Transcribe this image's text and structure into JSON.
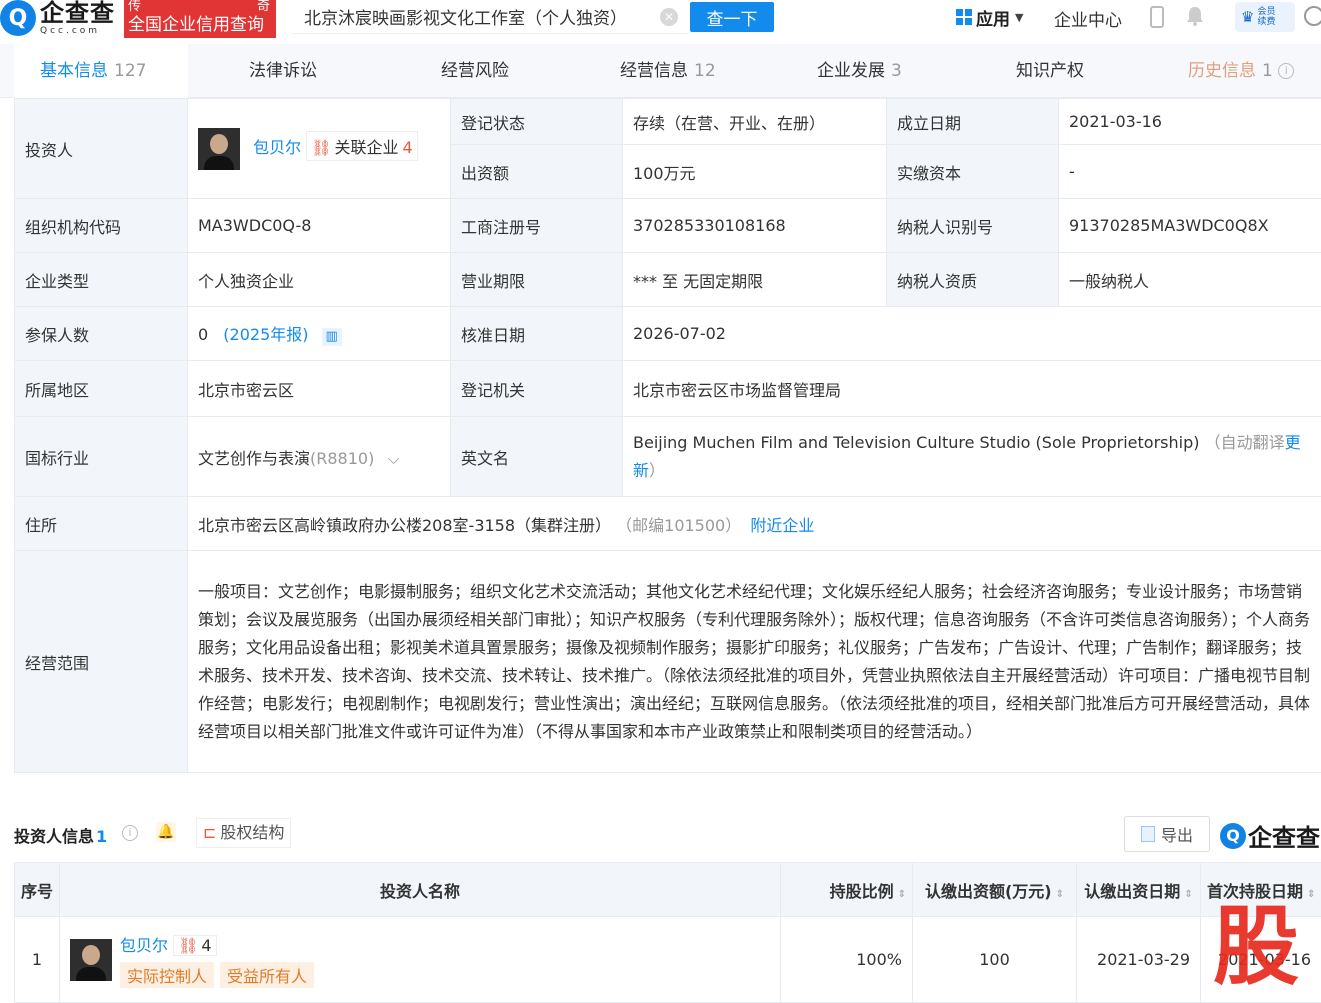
{
  "header": {
    "logo_name": "企查查",
    "logo_domain": "Qcc.com",
    "logo_red_top_left": "传",
    "logo_red_top_right": "奇",
    "logo_red_slogan": "全国企业信用查询",
    "search_value": "北京沐宸映画影视文化工作室（个人独资）",
    "search_button": "查一下",
    "app_menu": "应用",
    "enterprise_center": "企业中心",
    "vip_line1": "会员",
    "vip_line2": "续费"
  },
  "tabs": [
    {
      "label": "基本信息",
      "count": "127",
      "active": true
    },
    {
      "label": "法律诉讼",
      "count": ""
    },
    {
      "label": "经营风险",
      "count": ""
    },
    {
      "label": "经营信息",
      "count": "12"
    },
    {
      "label": "企业发展",
      "count": "3"
    },
    {
      "label": "知识产权",
      "count": ""
    },
    {
      "label": "历史信息",
      "count": "1"
    }
  ],
  "info": {
    "investor_label": "投资人",
    "investor_name": "包贝尔",
    "assoc_label": "关联企业",
    "assoc_count": "4",
    "reg_status_label": "登记状态",
    "reg_status": "存续（在营、开业、在册）",
    "est_date_label": "成立日期",
    "est_date": "2021-03-16",
    "capital_label": "出资额",
    "capital": "100万元",
    "paid_capital_label": "实缴资本",
    "paid_capital": "-",
    "org_code_label": "组织机构代码",
    "org_code": "MA3WDC0Q-8",
    "biz_reg_no_label": "工商注册号",
    "biz_reg_no": "370285330108168",
    "tax_id_label": "纳税人识别号",
    "tax_id": "91370285MA3WDC0Q8X",
    "ent_type_label": "企业类型",
    "ent_type": "个人独资企业",
    "biz_term_label": "营业期限",
    "biz_term": "*** 至 无固定期限",
    "tax_qual_label": "纳税人资质",
    "tax_qual": "一般纳税人",
    "insured_label": "参保人数",
    "insured": "0",
    "insured_year": "(2025年报)",
    "approve_date_label": "核准日期",
    "approve_date": "2026-07-02",
    "region_label": "所属地区",
    "region": "北京市密云区",
    "reg_authority_label": "登记机关",
    "reg_authority": "北京市密云区市场监督管理局",
    "industry_label": "国标行业",
    "industry": "文艺创作与表演",
    "industry_code": "(R8810)",
    "english_label": "英文名",
    "english_name": "Beijing Muchen Film and Television Culture Studio (Sole Proprietorship)",
    "english_note": "（自动翻译",
    "english_update": "更新",
    "english_close": "）",
    "address_label": "住所",
    "address": "北京市密云区高岭镇政府办公楼208室-3158（集群注册）",
    "postcode": "（邮编101500）",
    "nearby": "附近企业",
    "scope_label": "经营范围",
    "scope": "一般项目：文艺创作；电影摄制服务；组织文化艺术交流活动；其他文化艺术经纪代理；文化娱乐经纪人服务；社会经济咨询服务；专业设计服务；市场营销策划；会议及展览服务（出国办展须经相关部门审批）；知识产权服务（专利代理服务除外）；版权代理；信息咨询服务（不含许可类信息咨询服务）；个人商务服务；文化用品设备出租；影视美术道具置景服务；摄像及视频制作服务；摄影扩印服务；礼仪服务；广告发布；广告设计、代理；广告制作；翻译服务；技术服务、技术开发、技术咨询、技术交流、技术转让、技术推广。（除依法须经批准的项目外，凭营业执照依法自主开展经营活动）许可项目：广播电视节目制作经营；电影发行；电视剧制作；电视剧发行；营业性演出；演出经纪；互联网信息服务。（依法须经批准的项目，经相关部门批准后方可开展经营活动，具体经营项目以相关部门批准文件或许可证件为准）（不得从事国家和本市产业政策禁止和限制类项目的经营活动。）"
  },
  "investor_section": {
    "title": "投资人信息",
    "count": "1",
    "equity_button": "股权结构",
    "export_button": "导出",
    "logo_text": "企查查",
    "columns": [
      "序号",
      "投资人名称",
      "持股比例",
      "认缴出资额(万元)",
      "认缴出资日期",
      "首次持股日期"
    ],
    "rows": [
      {
        "index": "1",
        "name": "包贝尔",
        "assoc_count": "4",
        "tags": [
          "实际控制人",
          "受益所有人"
        ],
        "share": "100%",
        "subscribed": "100",
        "sub_date": "2021-03-29",
        "first_hold": "2021-03-16"
      }
    ]
  },
  "watermark": "股",
  "colors": {
    "brand_blue": "#128bed",
    "brand_red": "#e13434",
    "label_bg": "#f2f6fa",
    "tag_orange": "#e07b2a"
  }
}
